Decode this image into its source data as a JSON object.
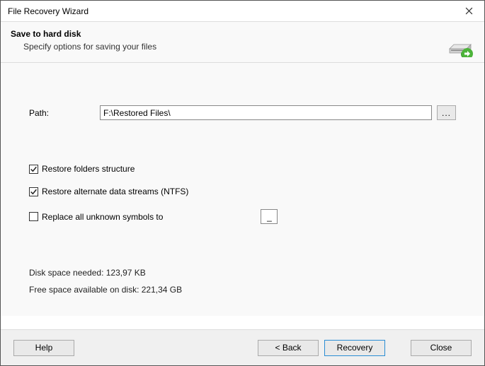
{
  "window": {
    "title": "File Recovery Wizard"
  },
  "header": {
    "title": "Save to hard disk",
    "subtitle": "Specify options for saving your files"
  },
  "path": {
    "label": "Path:",
    "value": "F:\\Restored Files\\",
    "browse_label": "..."
  },
  "options": {
    "restore_folders": {
      "label": "Restore folders structure",
      "checked": true
    },
    "restore_ads": {
      "label": "Restore alternate data streams (NTFS)",
      "checked": true
    },
    "replace_symbols": {
      "label": "Replace all unknown symbols to",
      "checked": false,
      "value": "_"
    }
  },
  "stats": {
    "disk_needed": "Disk space needed: 123,97 KB",
    "free_space": "Free space available on disk: 221,34 GB"
  },
  "buttons": {
    "help": "Help",
    "back": "< Back",
    "recovery": "Recovery",
    "close": "Close"
  }
}
